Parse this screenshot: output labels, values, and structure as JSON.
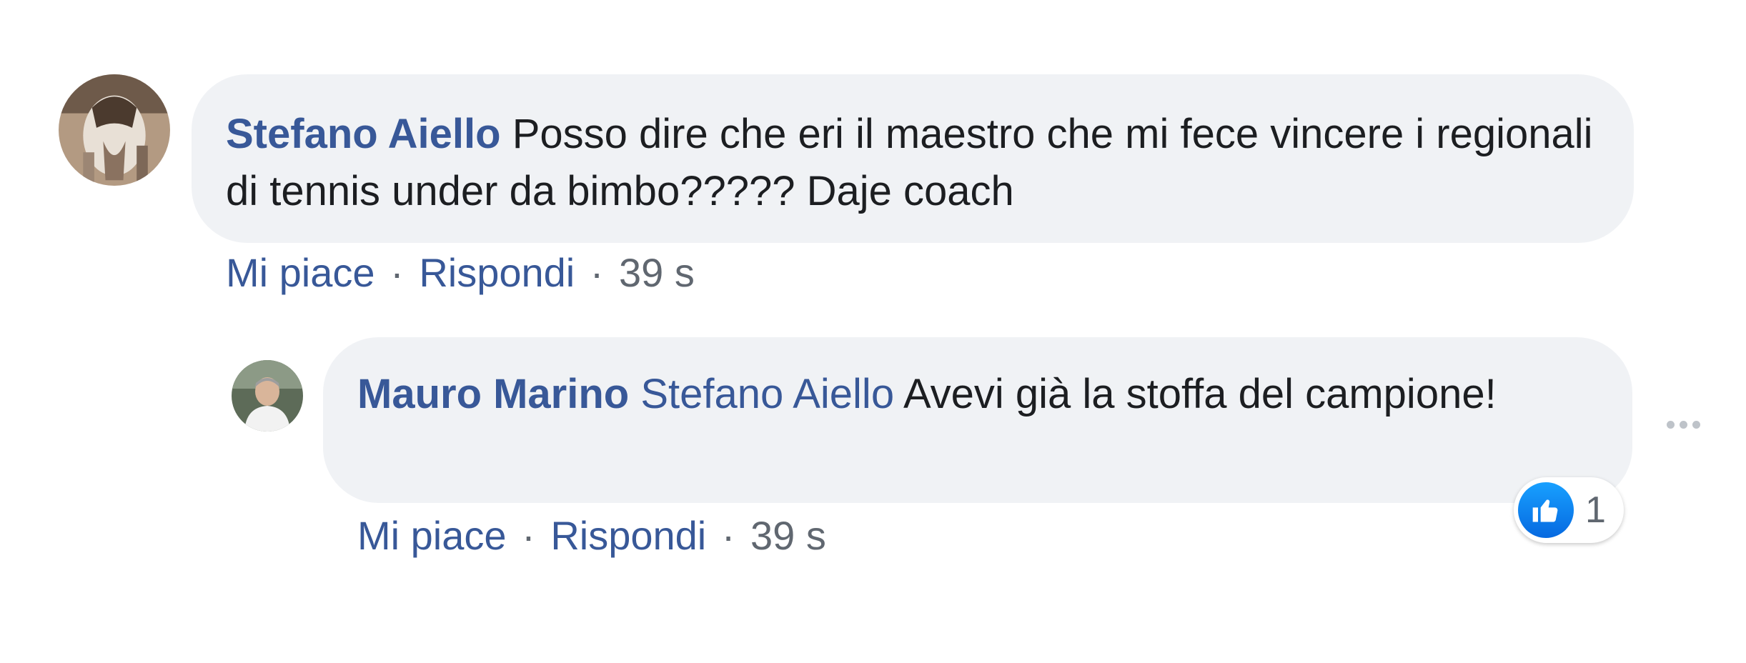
{
  "comments": [
    {
      "author": "Stefano Aiello",
      "text": "Posso dire che eri il maestro che mi fece vincere i regionali di tennis under da bimbo????? Daje coach",
      "actions": {
        "like": "Mi piace",
        "reply": "Rispondi",
        "time": "39 s",
        "separator": "·"
      }
    }
  ],
  "replies": [
    {
      "author": "Mauro Marino",
      "mention": "Stefano Aiello",
      "text": "Avevi già la stoffa del campione!",
      "actions": {
        "like": "Mi piace",
        "reply": "Rispondi",
        "time": "39 s",
        "separator": "·"
      },
      "reactions": {
        "icon": "thumbs-up-icon",
        "count": "1"
      },
      "menu_icon": "more-options-icon"
    }
  ],
  "colors": {
    "link": "#385898",
    "bubble": "#f0f2f5",
    "text": "#1c1e21",
    "meta": "#606770",
    "like": "#1877f2"
  }
}
